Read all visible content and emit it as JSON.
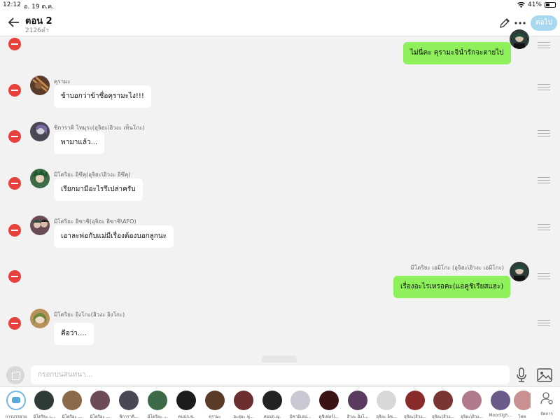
{
  "status": {
    "time": "12:12",
    "date": "อ. 19 ต.ค.",
    "battery": "41%"
  },
  "header": {
    "title": "ตอน 2",
    "subtitle": "2126คำ",
    "next_label": "ต่อไป"
  },
  "messages": [
    {
      "side": "right",
      "name": "",
      "text": "ไม่นี่คะ คุรามะจินํ่ารักจะตายไป",
      "avatar_color": "#2f3b37"
    },
    {
      "side": "left",
      "name": "คุรามะ",
      "text": "ข้าบอกว่าข้าชื่อคุรามะไง!!!",
      "avatar_color": "#5a3b2a"
    },
    {
      "side": "left",
      "name": "ชิการาคิ โทมุระ(อุจิฮะ\\ฮิวงะ เท็นโกะ)",
      "text": "พามาแล้ว...",
      "avatar_color": "#4a4656"
    },
    {
      "side": "left",
      "name": "มิโดริยะ อิซึคุ(อุจิฮะ\\ฮิวงะ อิซึคุ)",
      "text": "เรียกมามีอะไรรึเปล่าครับ",
      "avatar_color": "#3d6b47"
    },
    {
      "side": "left",
      "name": "มิโดริยะ ฮิซาชิ(อุจิฮะ ฮิซาชิ\\AFO)",
      "text": "เอาละพ่อกับแม่มีเรื่องต้องบอกลูกนะ",
      "avatar_color": "#6b4b55"
    },
    {
      "side": "right",
      "name": "มิโดริยะ เอมิโกะ (อุจิฮะ\\ฮิวงะ เอมิโกะ)",
      "text": "เรื่องอะไรเหรอคะ(แอคูชิเรียสแฮะ)",
      "avatar_color": "#2f3b37"
    },
    {
      "side": "left",
      "name": "มิโดริยะ อิงโกะ(ฮิวงะ อิงโกะ)",
      "text": "คือว่า....",
      "avatar_color": "#b8905a"
    }
  ],
  "input": {
    "placeholder": "กรอกบนสนทนา..."
  },
  "characters": [
    {
      "label": "การบรรยาย",
      "color": "#5aa7dc"
    },
    {
      "label": "มิโดริยะ เ...",
      "color": "#2f3b37"
    },
    {
      "label": "มิโดริยะ ...",
      "color": "#8a6a4a"
    },
    {
      "label": "มิโดริยะ ...",
      "color": "#6b4b55"
    },
    {
      "label": "ชิการาคิ...",
      "color": "#4a4656"
    },
    {
      "label": "มิโดริยะ ...",
      "color": "#3d6b47"
    },
    {
      "label": "คนปก.ช.",
      "color": "#1c1c1c"
    },
    {
      "label": "คุรามะ",
      "color": "#5a3b2a"
    },
    {
      "label": "อะสุยะ ฟู...",
      "color": "#6b2f2f"
    },
    {
      "label": "คนปก.ญ.",
      "color": "#222222"
    },
    {
      "label": "มิคามิเลป...",
      "color": "#c9c9d6"
    },
    {
      "label": "ดูชิเฟอร์(...",
      "color": "#3a1414"
    },
    {
      "label": "ฮิวงะ อิงโ...",
      "color": "#5a3b5e"
    },
    {
      "label": "อุจิฮะ อิซ...",
      "color": "#d8d8d8"
    },
    {
      "label": "อุจิฮะ\\ฮิวง...",
      "color": "#8a2b2b"
    },
    {
      "label": "อุจิฮะ\\ฮิวง...",
      "color": "#7a3434"
    },
    {
      "label": "อุจิฮะ\\ฮิวง...",
      "color": "#b07a8a"
    },
    {
      "label": "Moonligh...",
      "color": "#6a5a8a"
    },
    {
      "label": "ไทท",
      "color": "#c89090"
    }
  ],
  "manage_label": "จัดการ",
  "colors": {
    "accent": "#74b9e6",
    "green_bubble": "#8ef05a",
    "delete": "#e8403a"
  }
}
